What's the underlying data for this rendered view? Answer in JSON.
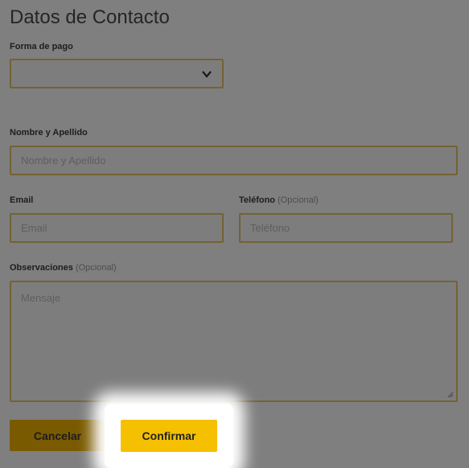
{
  "form": {
    "title": "Datos de Contacto",
    "forma_pago_label": "Forma de pago",
    "forma_pago_value": "",
    "nombre_label": "Nombre y Apellido",
    "nombre_placeholder": "Nombre y Apellido",
    "email_label": "Email",
    "email_placeholder": "Email",
    "telefono_label": "Teléfono",
    "telefono_optional": "(Opcional)",
    "telefono_placeholder": "Teléfono",
    "observaciones_label": "Observaciones",
    "observaciones_optional": "(Opcional)",
    "observaciones_placeholder": "Mensaje"
  },
  "buttons": {
    "cancel_label": "Cancelar",
    "confirm_label": "Confirmar"
  },
  "colors": {
    "accent": "#f5c000",
    "field_border": "#e8c56a"
  },
  "icons": {
    "select_arrow": "chevron-down-icon",
    "resize_handle": "resize-handle-icon"
  }
}
